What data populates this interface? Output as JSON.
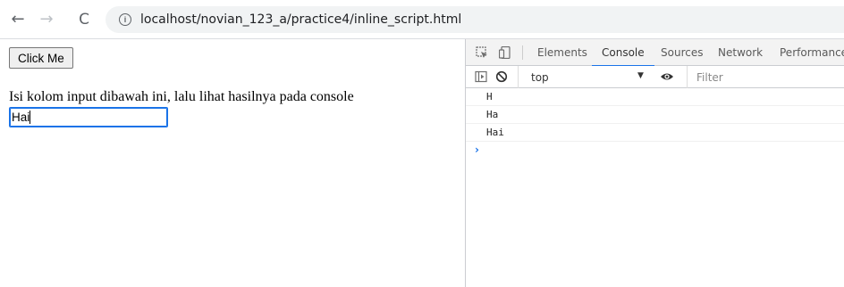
{
  "browser": {
    "back_icon": "arrow-left-icon",
    "forward_icon": "arrow-right-icon",
    "reload_icon": "reload-icon",
    "info_icon": "info-icon",
    "url": "localhost/novian_123_a/practice4/inline_script.html"
  },
  "page": {
    "button_label": "Click Me",
    "instruction": "Isi kolom input dibawah ini, lalu lihat hasilnya pada console",
    "input_value": "Hai"
  },
  "devtools": {
    "tabs": [
      "Elements",
      "Console",
      "Sources",
      "Network",
      "Performance"
    ],
    "active_tab": "Console",
    "context": "top",
    "filter_placeholder": "Filter",
    "logs": [
      "H",
      "Ha",
      "Hai"
    ],
    "prompt_symbol": "›",
    "accent_color": "#1a73e8"
  }
}
